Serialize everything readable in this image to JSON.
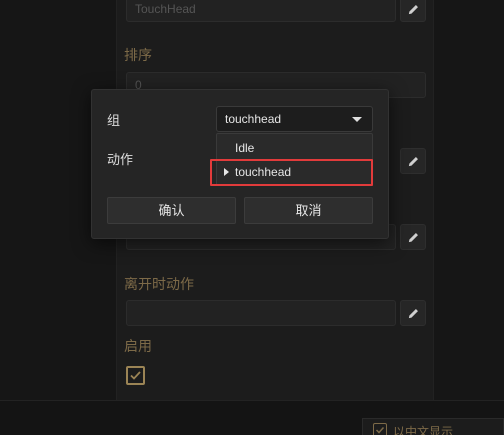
{
  "panel": {
    "name_value": "TouchHead",
    "order_label": "排序",
    "order_value": "0",
    "leave_action_label": "离开时动作",
    "enable_label": "启用"
  },
  "bottom": {
    "chinese_display_label": "以中文显示"
  },
  "dialog": {
    "group_label": "组",
    "group_selected": "touchhead",
    "action_label": "动作",
    "options": [
      "Idle",
      "touchhead"
    ],
    "confirm_label": "确认",
    "cancel_label": "取消"
  }
}
